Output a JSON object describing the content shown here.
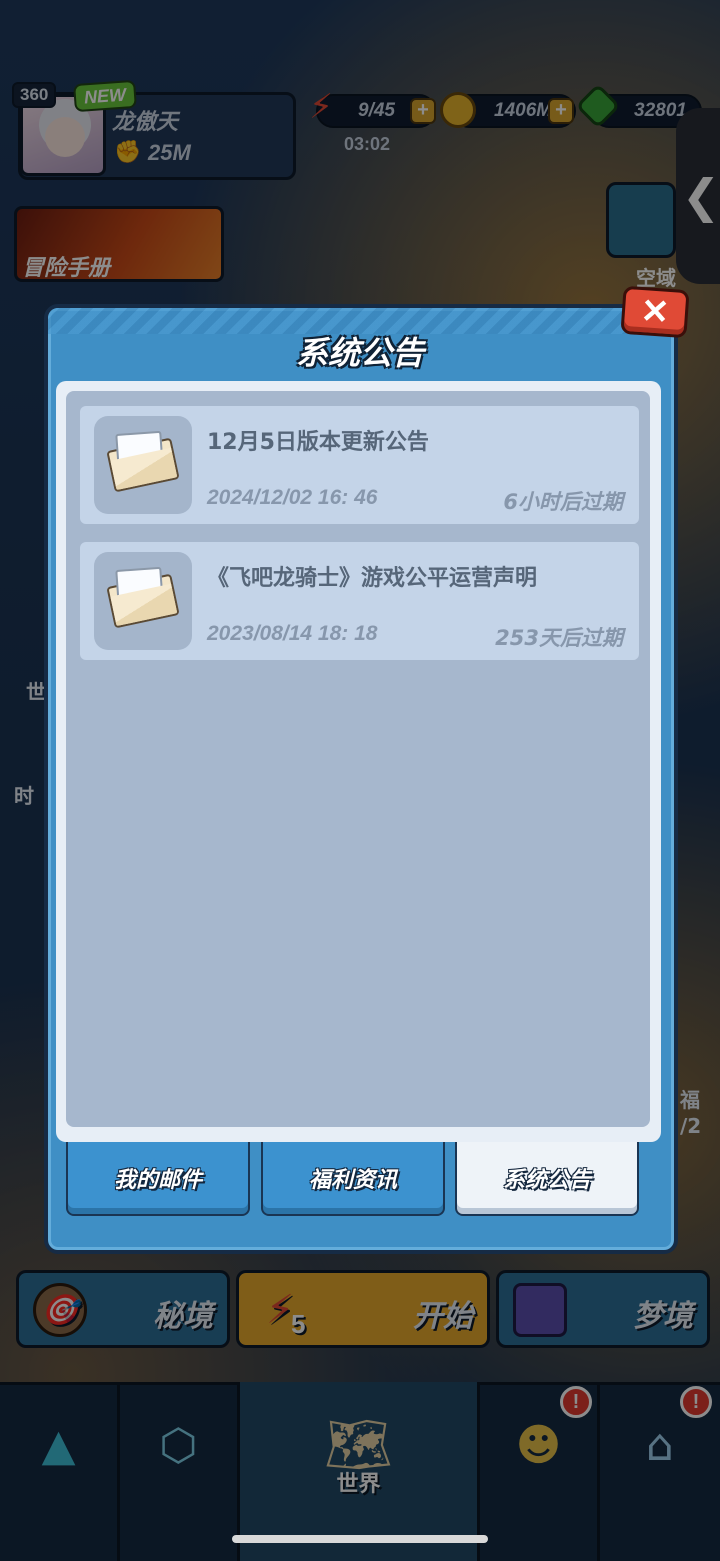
{
  "player": {
    "level": "360",
    "new_badge": "NEW",
    "name": "龙傲天",
    "power": "25M"
  },
  "resources": {
    "energy": "9/45",
    "energy_timer": "03:02",
    "gold": "1406M",
    "gems": "32801",
    "plus_symbol": "+"
  },
  "side": {
    "adventure_manual": "冒险手册",
    "sky_domain": "空域",
    "handle_glyph": "❮",
    "peek_left_1": "世",
    "peek_left_2": "时",
    "peek_right_1": "福",
    "peek_right_2": "/2"
  },
  "modal": {
    "title": "系统公告",
    "close_glyph": "✕",
    "notices": [
      {
        "title": "12月5日版本更新公告",
        "date": "2024/12/02 16: 46",
        "expiry": "6小时后过期"
      },
      {
        "title": "《飞吧龙骑士》游戏公平运营声明",
        "date": "2023/08/14 18: 18",
        "expiry": "253天后过期"
      }
    ],
    "tabs": [
      "我的邮件",
      "福利资讯",
      "系统公告"
    ],
    "active_tab": "系统公告"
  },
  "modes": {
    "secret_realm": "秘境",
    "start": "开始",
    "start_cost": "5",
    "dream_realm": "梦境"
  },
  "bottom_nav": {
    "world": "世界",
    "badge_glyph": "!"
  },
  "colors": {
    "modal_blue": "#3f8fc5",
    "active_tab": "#eef3f8",
    "close_red": "#e04a36",
    "notice_bg": "#c4d4e8"
  }
}
